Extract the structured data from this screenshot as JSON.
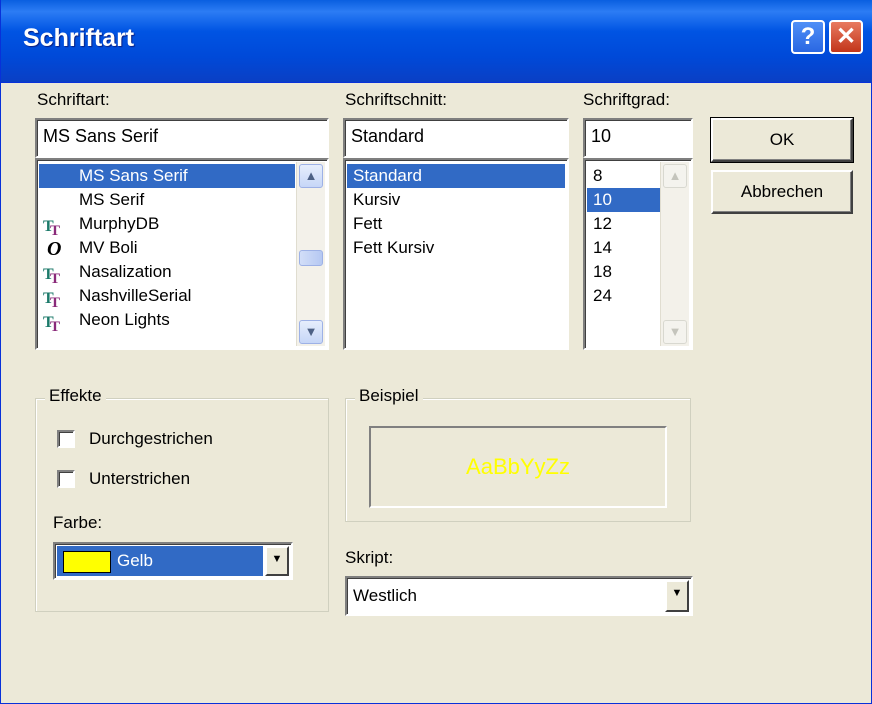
{
  "window": {
    "title": "Schriftart",
    "help_glyph": "?",
    "close_glyph": "✕"
  },
  "font": {
    "label": "Schriftart:",
    "value": "MS Sans Serif",
    "items": [
      {
        "name": "MS Sans Serif",
        "icon": "none",
        "selected": true
      },
      {
        "name": "MS Serif",
        "icon": "none",
        "selected": false
      },
      {
        "name": "MurphyDB",
        "icon": "truetype-icon",
        "selected": false
      },
      {
        "name": "MV Boli",
        "icon": "opentype-icon",
        "selected": false
      },
      {
        "name": "Nasalization",
        "icon": "truetype-icon",
        "selected": false
      },
      {
        "name": "NashvilleSerial",
        "icon": "truetype-icon",
        "selected": false
      },
      {
        "name": "Neon Lights",
        "icon": "truetype-icon",
        "selected": false
      }
    ]
  },
  "style": {
    "label": "Schriftschnitt:",
    "value": "Standard",
    "items": [
      {
        "name": "Standard",
        "selected": true
      },
      {
        "name": "Kursiv",
        "selected": false
      },
      {
        "name": "Fett",
        "selected": false
      },
      {
        "name": "Fett Kursiv",
        "selected": false
      }
    ]
  },
  "size": {
    "label": "Schriftgrad:",
    "value": "10",
    "items": [
      {
        "name": "8",
        "selected": false
      },
      {
        "name": "10",
        "selected": true
      },
      {
        "name": "12",
        "selected": false
      },
      {
        "name": "14",
        "selected": false
      },
      {
        "name": "18",
        "selected": false
      },
      {
        "name": "24",
        "selected": false
      }
    ]
  },
  "buttons": {
    "ok": "OK",
    "cancel": "Abbrechen"
  },
  "effects": {
    "title": "Effekte",
    "strikethrough": "Durchgestrichen",
    "underline": "Unterstrichen",
    "color_label": "Farbe:",
    "color_value": "Gelb",
    "color_swatch": "#ffff00"
  },
  "sample": {
    "title": "Beispiel",
    "text": "AaBbYyZz",
    "color": "#ffff00"
  },
  "script": {
    "label": "Skript:",
    "value": "Westlich"
  },
  "colors": {
    "selection": "#316ac5",
    "dialog_bg": "#ece9d8",
    "titlebar": "#0054e3"
  }
}
